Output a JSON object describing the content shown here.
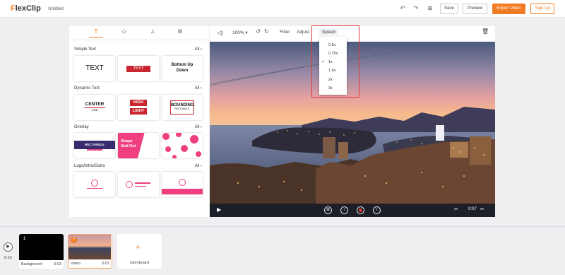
{
  "header": {
    "logo_prefix": "F",
    "logo_rest": "lexClip",
    "project_title": "Untitled",
    "undo_icon": "↶",
    "redo_icon": "↷",
    "grid_icon": "⊞",
    "save_label": "Save",
    "preview_label": "Preview",
    "export_label": "Export Video",
    "signup_label": "Sign Up"
  },
  "left_panel": {
    "tabs": [
      {
        "icon": "text-icon",
        "glyph": "T"
      },
      {
        "icon": "shapes-icon",
        "glyph": "◇"
      },
      {
        "icon": "music-icon",
        "glyph": "♫"
      },
      {
        "icon": "element-icon",
        "glyph": "⚙"
      }
    ],
    "all_label": "All",
    "sections": [
      {
        "title": "Simple Text",
        "cards": [
          "TEXT",
          "TEXT",
          "Bottom Up Down"
        ]
      },
      {
        "title": "Dynamic Text",
        "cards": [
          "CENTER",
          "HIGH",
          "BOUNDING"
        ]
      },
      {
        "title": "Overlay",
        "cards": [
          "RECTANGLE",
          "Shape Roll Out",
          ""
        ]
      },
      {
        "title": "Logo/Intro/Outro",
        "cards": [
          "",
          "",
          ""
        ]
      }
    ],
    "card_sub": {
      "center": "LINE",
      "light": "LIGHT",
      "bounding": "RECTANGLE"
    }
  },
  "preview": {
    "volume_icon": "🔈",
    "zoom": "100%",
    "filter_label": "Filter",
    "adjust_label": "Adjust",
    "speed_label": "Speed",
    "time": "0:07"
  },
  "speed_menu": {
    "options": [
      "0.5x",
      "0.75x",
      "1x",
      "1.5x",
      "2x",
      "3x"
    ],
    "selected": "1x",
    "check": "✓"
  },
  "timeline": {
    "total_time": "0:10",
    "clips": [
      {
        "number": "1",
        "label": "Background",
        "duration": "0:03"
      },
      {
        "number": "2",
        "label": "Video",
        "duration": "0:07"
      }
    ],
    "add_label": "Storyboard"
  },
  "colors": {
    "accent": "#f17b22",
    "highlight": "#e6393a"
  }
}
